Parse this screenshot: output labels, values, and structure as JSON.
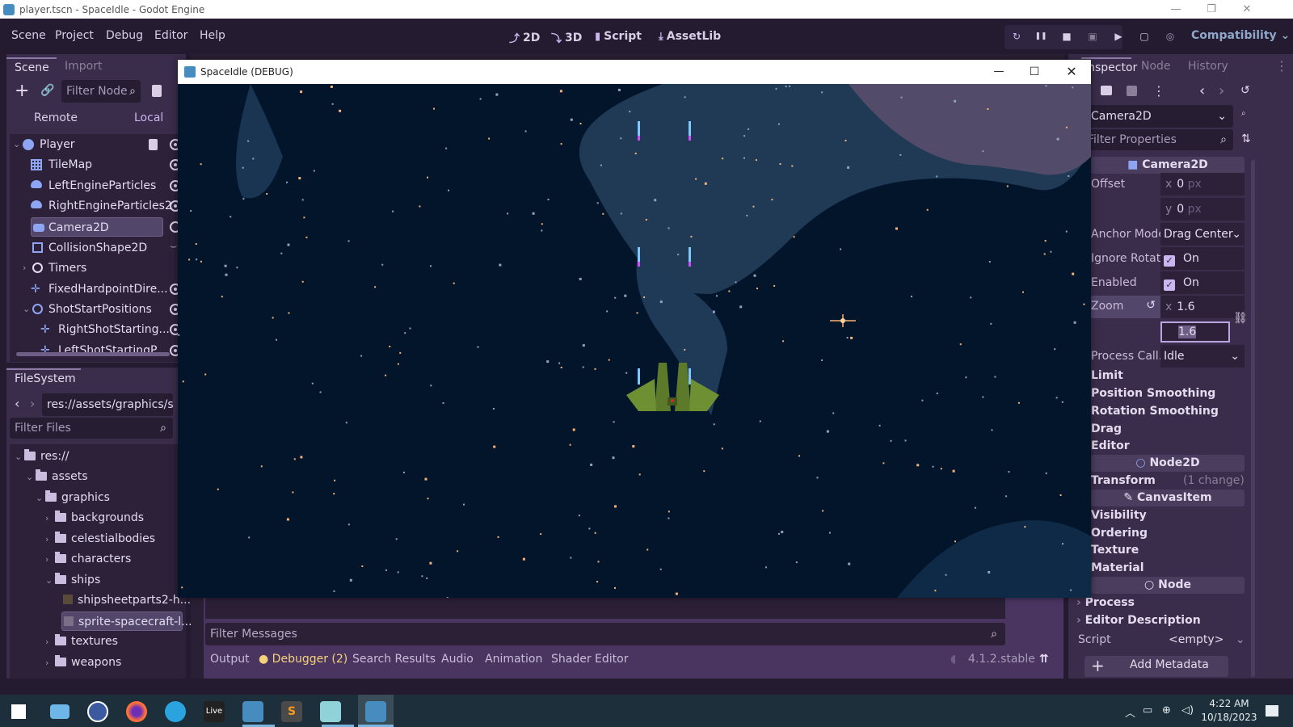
{
  "os_window": {
    "title": "player.tscn - SpaceIdle - Godot Engine",
    "controls": {
      "minimize": "—",
      "restore": "❐",
      "close": "✕"
    }
  },
  "menubar": {
    "items": [
      "Scene",
      "Project",
      "Debug",
      "Editor",
      "Help"
    ],
    "modes": [
      {
        "icon": "2d-icon",
        "glyph": "⤴",
        "label": "2D"
      },
      {
        "icon": "3d-icon",
        "glyph": "⤵",
        "label": "3D"
      },
      {
        "icon": "script-icon",
        "glyph": "▮",
        "label": "Script"
      },
      {
        "icon": "assetlib-icon",
        "glyph": "⤓",
        "label": "AssetLib"
      }
    ],
    "run_buttons": [
      {
        "name": "reload-icon",
        "glyph": "↻"
      },
      {
        "name": "pause-icon",
        "glyph": "❚❚"
      },
      {
        "name": "stop-icon",
        "glyph": "■"
      },
      {
        "name": "remote-debug-icon",
        "glyph": "▣"
      },
      {
        "name": "play-scene-icon",
        "glyph": "▶"
      },
      {
        "name": "play-custom-icon",
        "glyph": "▢"
      },
      {
        "name": "movie-maker-icon",
        "glyph": "◎"
      }
    ],
    "renderer": "Compatibility"
  },
  "scene_dock": {
    "tabs": [
      "Scene",
      "Import"
    ],
    "active_tab": "Scene",
    "filter_placeholder": "Filter Node",
    "remote_label": "Remote",
    "local_label": "Local",
    "nodes": [
      {
        "label": "Player",
        "icon": "globe-icon",
        "color": "#8da5f3",
        "depth": 0,
        "expanded": true,
        "has_script": true,
        "visible_toggle": true
      },
      {
        "label": "TileMap",
        "icon": "tilemap-icon",
        "color": "#8da5f3",
        "depth": 1,
        "visible_toggle": true
      },
      {
        "label": "LeftEngineParticles",
        "icon": "particles-icon",
        "color": "#8da5f3",
        "depth": 1,
        "visible_toggle": true
      },
      {
        "label": "RightEngineParticles2",
        "icon": "particles-icon",
        "color": "#8da5f3",
        "depth": 1,
        "visible_toggle": true
      },
      {
        "label": "Camera2D",
        "icon": "camera-icon",
        "color": "#8da5f3",
        "depth": 1,
        "selected": true,
        "visible_toggle": true
      },
      {
        "label": "CollisionShape2D",
        "icon": "collision-shape-icon",
        "color": "#8da5f3",
        "depth": 1,
        "warning": true
      },
      {
        "label": "Timers",
        "icon": "node-icon",
        "color": "#e3dbee",
        "depth": 1,
        "collapsed": true
      },
      {
        "label": "FixedHardpointDire...",
        "icon": "marker-icon",
        "color": "#8da5f3",
        "depth": 1,
        "visible_toggle": true
      },
      {
        "label": "ShotStartPositions",
        "icon": "node2d-icon",
        "color": "#8da5f3",
        "depth": 1,
        "expanded": true,
        "visible_toggle": true
      },
      {
        "label": "RightShotStarting...",
        "icon": "marker-icon",
        "color": "#8da5f3",
        "depth": 2,
        "visible_toggle": true
      },
      {
        "label": "LeftShotStartingP...",
        "icon": "marker-icon",
        "color": "#8da5f3",
        "depth": 2,
        "visible_toggle": true
      }
    ]
  },
  "filesystem_dock": {
    "title": "FileSystem",
    "path": "res://assets/graphics/s",
    "filter_placeholder": "Filter Files",
    "items": [
      {
        "label": "res://",
        "type": "folder",
        "depth": 0,
        "expanded": true
      },
      {
        "label": "assets",
        "type": "folder",
        "depth": 1,
        "expanded": true
      },
      {
        "label": "graphics",
        "type": "folder",
        "depth": 2,
        "expanded": true
      },
      {
        "label": "backgrounds",
        "type": "folder",
        "depth": 3
      },
      {
        "label": "celestialbodies",
        "type": "folder",
        "depth": 3
      },
      {
        "label": "characters",
        "type": "folder",
        "depth": 3
      },
      {
        "label": "ships",
        "type": "folder",
        "depth": 3,
        "expanded": true
      },
      {
        "label": "shipsheetparts2-h...",
        "type": "image",
        "depth": 4
      },
      {
        "label": "sprite-spacecraft-l...",
        "type": "image",
        "depth": 4,
        "selected": true
      },
      {
        "label": "textures",
        "type": "folder",
        "depth": 3
      },
      {
        "label": "weapons",
        "type": "folder",
        "depth": 3
      }
    ]
  },
  "game_window": {
    "title": "SpaceIdle (DEBUG)",
    "controls": {
      "minimize": "—",
      "maximize": "☐",
      "close": "✕"
    }
  },
  "bottom_panel": {
    "filter_placeholder": "Filter Messages",
    "tabs": [
      {
        "label": "Output"
      },
      {
        "label": "Debugger (2)",
        "warning_dot": true,
        "color": "#f5d27a"
      },
      {
        "label": "Search Results"
      },
      {
        "label": "Audio"
      },
      {
        "label": "Animation"
      },
      {
        "label": "Shader Editor"
      }
    ],
    "version": "4.1.2.stable"
  },
  "inspector": {
    "tabs": [
      "Inspector",
      "Node",
      "History"
    ],
    "active_tab": "Inspector",
    "selected_node": "Camera2D",
    "filter_placeholder": "Filter Properties",
    "sections": [
      {
        "label": "Camera2D",
        "icon": "camera-icon"
      }
    ],
    "properties": {
      "offset": {
        "label": "Offset",
        "x": "0",
        "y": "0",
        "unit": "px"
      },
      "anchor_mode": {
        "label": "Anchor Mode",
        "value": "Drag Center"
      },
      "ignore_rotation": {
        "label": "Ignore Rotat...",
        "value": "On",
        "checked": true
      },
      "enabled": {
        "label": "Enabled",
        "value": "On",
        "checked": true
      },
      "zoom": {
        "label": "Zoom",
        "x": "1.6",
        "y": "1.6"
      },
      "process_callback": {
        "label": "Process Call...",
        "value": "Idle"
      }
    },
    "camera_groups": [
      "Limit",
      "Position Smoothing",
      "Rotation Smoothing",
      "Drag",
      "Editor"
    ],
    "node2d_section": "Node2D",
    "transform": {
      "label": "Transform",
      "changes": "(1 change)"
    },
    "canvasitem_section": "CanvasItem",
    "canvasitem_groups": [
      "Visibility",
      "Ordering",
      "Texture",
      "Material"
    ],
    "node_section": "Node",
    "node_groups": [
      "Process",
      "Editor Description"
    ],
    "script": {
      "label": "Script",
      "value": "<empty>"
    },
    "add_metadata": "Add Metadata"
  },
  "taskbar": {
    "apps": [
      {
        "name": "start-icon",
        "color": "#ffffff"
      },
      {
        "name": "this-pc-icon",
        "color": "#6fb6e8"
      },
      {
        "name": "keepass-icon",
        "color": "#3b5aa0"
      },
      {
        "name": "firefox-icon",
        "color": "#ff7139"
      },
      {
        "name": "telegram-icon",
        "color": "#2aa3df"
      },
      {
        "name": "live-icon",
        "label": "Live",
        "color": "#222222"
      },
      {
        "name": "godot-console-icon",
        "color": "#478cbf"
      },
      {
        "name": "sublime-icon",
        "color": "#f79a1a"
      },
      {
        "name": "notepad-icon",
        "color": "#8fd3d8"
      },
      {
        "name": "godot-icon",
        "color": "#478cbf",
        "active": true
      }
    ],
    "time": "4:22 AM",
    "date": "10/18/2023"
  }
}
